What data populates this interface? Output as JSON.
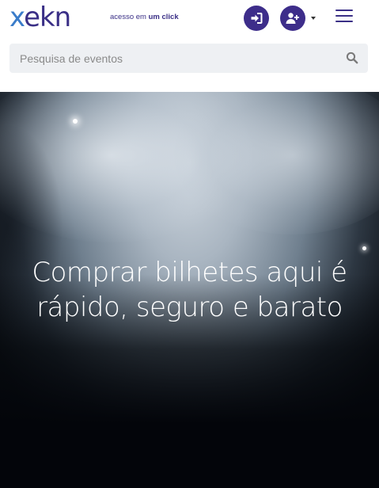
{
  "header": {
    "logo_text": "xekn",
    "tagline_prefix": "acesso em",
    "tagline_bold": "um click",
    "login_icon": "sign-in-icon",
    "register_icon": "user-plus-icon",
    "menu_icon": "hamburger-menu-icon"
  },
  "search": {
    "placeholder": "Pesquisa de eventos",
    "value": "",
    "icon": "search-icon"
  },
  "hero": {
    "title_line1": "Comprar bilhetes aqui é",
    "title_line2": "rápido, seguro e barato"
  },
  "colors": {
    "brand_purple": "#3d2d8a",
    "brand_blue": "#3a7cc9",
    "search_bg": "#eef0f3"
  }
}
